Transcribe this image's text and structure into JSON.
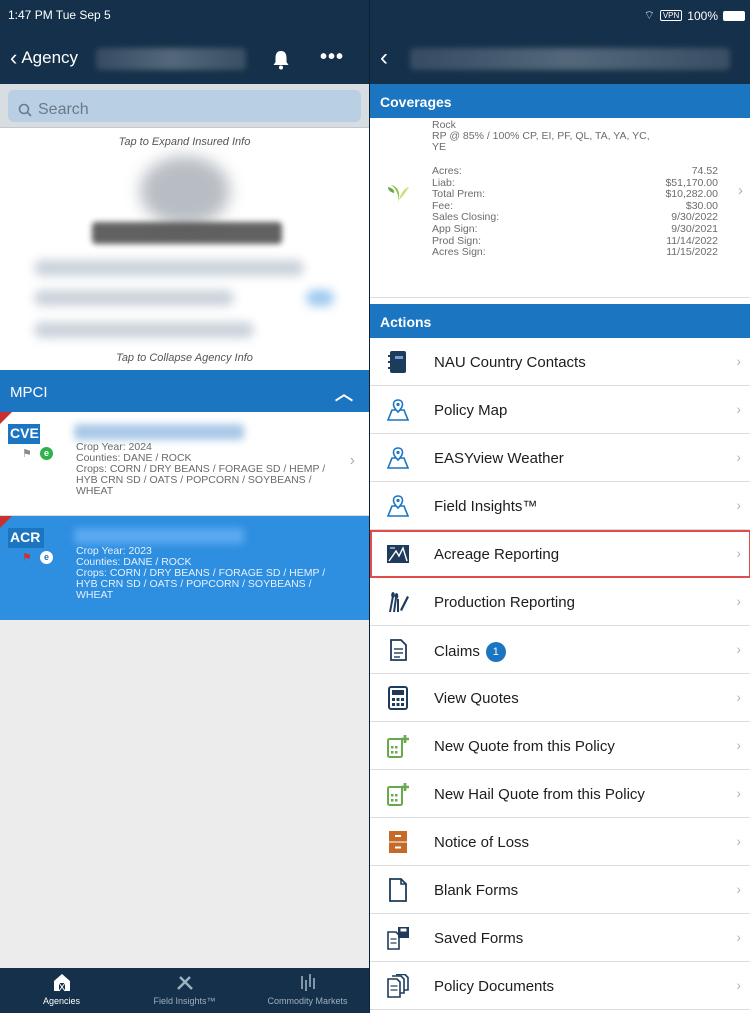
{
  "status_bar": {
    "time_day": "1:47 PM  Tue Sep 5",
    "vpn": "VPN",
    "battery": "100%"
  },
  "left_nav": {
    "back_label": "Agency"
  },
  "search": {
    "placeholder": "Search"
  },
  "insured": {
    "expand_hint": "Tap to Expand Insured Info",
    "collapse_hint": "Tap to Collapse Agency Info"
  },
  "mpci": {
    "title": "MPCI"
  },
  "policies": [
    {
      "badge": "CVE",
      "crop_year": "Crop Year: 2024",
      "counties": "Counties: DANE / ROCK",
      "crops": "Crops: CORN / DRY BEANS / FORAGE SD / HEMP / HYB CRN SD / OATS / POPCORN / SOYBEANS / WHEAT",
      "status": "e"
    },
    {
      "badge": "ACR",
      "crop_year": "Crop Year: 2023",
      "counties": "Counties: DANE / ROCK",
      "crops": "Crops: CORN / DRY BEANS / FORAGE SD / HEMP / HYB CRN SD / OATS / POPCORN / SOYBEANS / WHEAT",
      "status": "e"
    }
  ],
  "tabs": [
    {
      "label": "Agencies",
      "icon": "barn-icon"
    },
    {
      "label": "Field Insights™",
      "icon": "tools-icon"
    },
    {
      "label": "Commodity Markets",
      "icon": "chart-icon"
    }
  ],
  "coverages": {
    "title": "Coverages",
    "county": "Rock",
    "plan": "RP @ 85% / 100% CP, EI, PF, QL, TA, YA, YC, YE",
    "rows": [
      {
        "label": "Acres:",
        "value": "74.52"
      },
      {
        "label": "Liab:",
        "value": "$51,170.00"
      },
      {
        "label": "Total Prem:",
        "value": "$10,282.00"
      },
      {
        "label": "Fee:",
        "value": "$30.00"
      },
      {
        "label": "Sales Closing:",
        "value": "9/30/2022"
      },
      {
        "label": "App Sign:",
        "value": "9/30/2021"
      },
      {
        "label": "Prod Sign:",
        "value": "11/14/2022"
      },
      {
        "label": "Acres Sign:",
        "value": "11/15/2022"
      }
    ]
  },
  "actions": {
    "title": "Actions",
    "items": [
      {
        "label": "NAU Country Contacts",
        "icon": "contacts-book-icon",
        "color": "#1f3b5c"
      },
      {
        "label": "Policy Map",
        "icon": "map-pin-icon",
        "color": "#1b75c0"
      },
      {
        "label": "EASYview Weather",
        "icon": "map-pin-icon",
        "color": "#1b75c0"
      },
      {
        "label": "Field Insights™",
        "icon": "map-pin-icon",
        "color": "#1b75c0"
      },
      {
        "label": "Acreage Reporting",
        "icon": "acreage-map-icon",
        "color": "#1f3b5c"
      },
      {
        "label": "Production Reporting",
        "icon": "wheat-pen-icon",
        "color": "#1f3b5c"
      },
      {
        "label": "Claims",
        "icon": "document-icon",
        "color": "#1f3b5c",
        "badge": "1"
      },
      {
        "label": "View Quotes",
        "icon": "calculator-icon",
        "color": "#1f3b5c"
      },
      {
        "label": "New Quote from this Policy",
        "icon": "calculator-plus-icon",
        "color": "#6aa84f"
      },
      {
        "label": "New Hail Quote from this Policy",
        "icon": "calculator-plus-icon",
        "color": "#6aa84f"
      },
      {
        "label": "Notice of Loss",
        "icon": "file-cabinet-icon",
        "color": "#c56b2a"
      },
      {
        "label": "Blank Forms",
        "icon": "blank-page-icon",
        "color": "#1f3b5c"
      },
      {
        "label": "Saved Forms",
        "icon": "saved-forms-icon",
        "color": "#1f3b5c"
      },
      {
        "label": "Policy Documents",
        "icon": "documents-icon",
        "color": "#1f3b5c"
      }
    ]
  }
}
